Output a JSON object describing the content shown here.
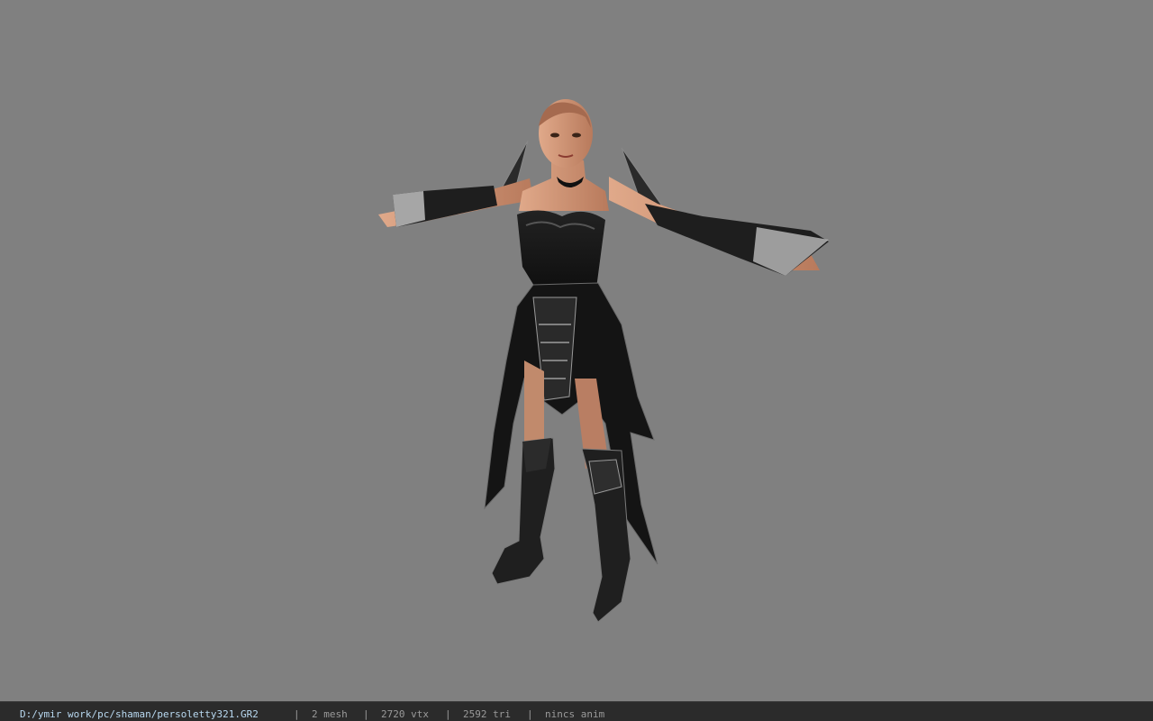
{
  "statusbar": {
    "file_path": "D:/ymir work/pc/shaman/persoletty321.GR2",
    "separator": "|",
    "mesh_count": "2 mesh",
    "vertex_count": "2720 vtx",
    "triangle_count": "2592 tri",
    "animation": "nincs anim"
  },
  "colors": {
    "background": "#808080",
    "statusbar_bg": "#2b2b2b",
    "path_text": "#b8d8f0",
    "info_text": "#9a9a9a"
  }
}
